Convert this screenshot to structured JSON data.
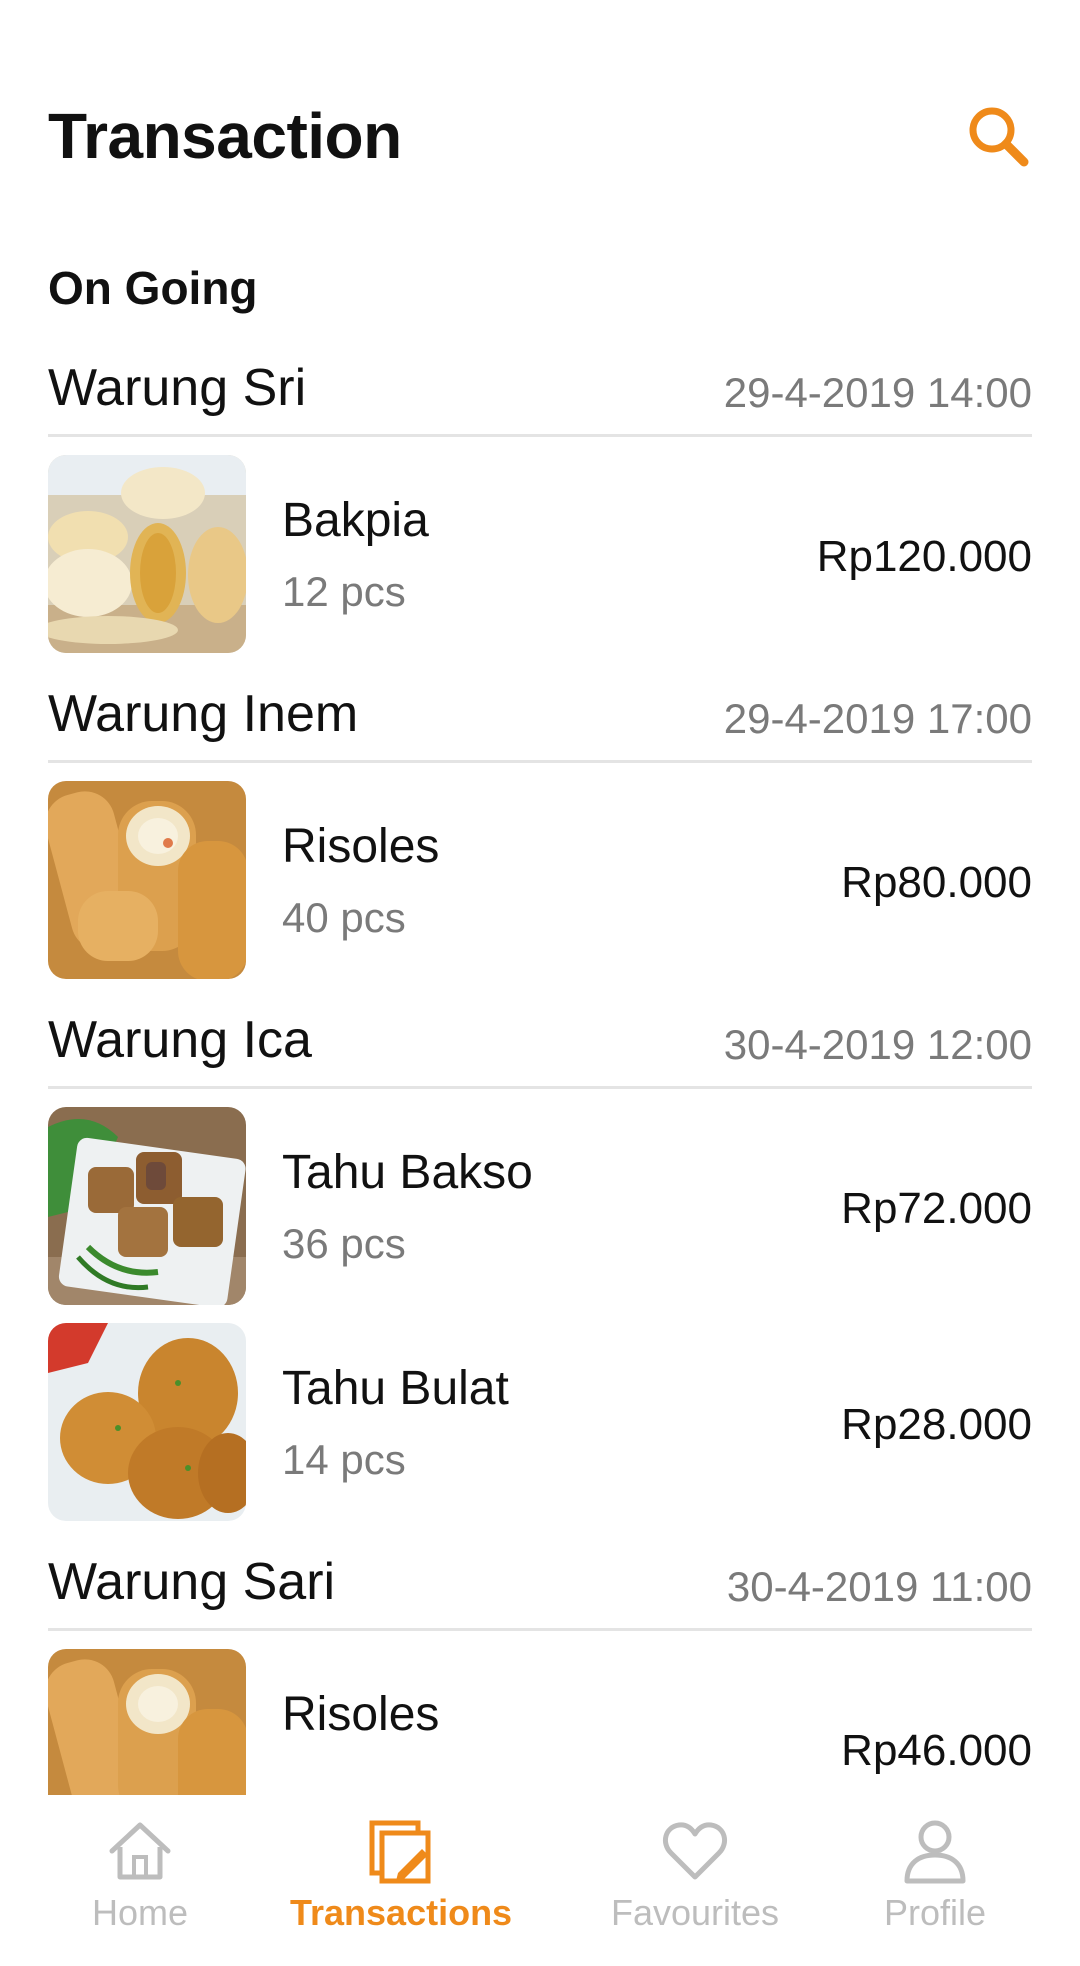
{
  "header": {
    "title": "Transaction",
    "search_icon": "search-icon",
    "accent_color": "#ef8a1a"
  },
  "section": {
    "label": "On Going"
  },
  "orders": [
    {
      "shop": "Warung Sri",
      "datetime": "29-4-2019 14:00",
      "items": [
        {
          "name": "Bakpia",
          "qty": "12 pcs",
          "price": "Rp120.000",
          "thumb": "bakpia-photo"
        }
      ]
    },
    {
      "shop": "Warung Inem",
      "datetime": "29-4-2019 17:00",
      "items": [
        {
          "name": "Risoles",
          "qty": "40 pcs",
          "price": "Rp80.000",
          "thumb": "risoles-photo"
        }
      ]
    },
    {
      "shop": "Warung Ica",
      "datetime": "30-4-2019 12:00",
      "items": [
        {
          "name": "Tahu Bakso",
          "qty": "36 pcs",
          "price": "Rp72.000",
          "thumb": "tahu-bakso-photo"
        },
        {
          "name": "Tahu Bulat",
          "qty": "14 pcs",
          "price": "Rp28.000",
          "thumb": "tahu-bulat-photo"
        }
      ]
    },
    {
      "shop": "Warung Sari",
      "datetime": "30-4-2019 11:00",
      "items": [
        {
          "name": "Risoles",
          "qty": "",
          "price": "Rp46.000",
          "thumb": "risoles-photo"
        }
      ]
    }
  ],
  "bottom_nav": [
    {
      "label": "Home",
      "icon": "home-icon",
      "active": false
    },
    {
      "label": "Transactions",
      "icon": "transactions-icon",
      "active": true
    },
    {
      "label": "Favourites",
      "icon": "heart-icon",
      "active": false
    },
    {
      "label": "Profile",
      "icon": "person-icon",
      "active": false
    }
  ],
  "colors": {
    "active": "#ef8a1a",
    "inactive": "#bdbdbd",
    "muted_text": "#7a7a7a",
    "divider": "#e4e4e4"
  }
}
